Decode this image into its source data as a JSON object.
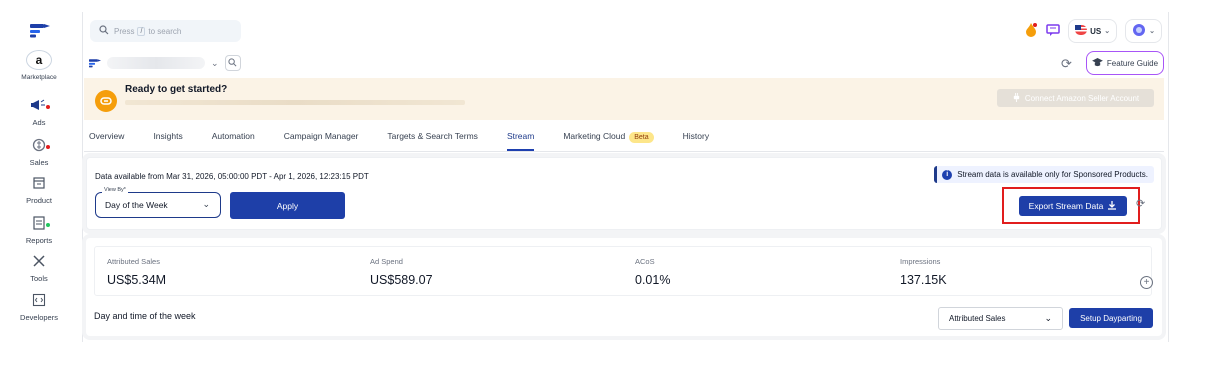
{
  "rail": {
    "marketplace_label": "Marketplace",
    "marketplace_badge": "a",
    "items": [
      {
        "label": "Ads",
        "icon": "megaphone-icon"
      },
      {
        "label": "Sales",
        "icon": "sales-icon"
      },
      {
        "label": "Product",
        "icon": "product-box-icon"
      },
      {
        "label": "Reports",
        "icon": "reports-icon"
      },
      {
        "label": "Tools",
        "icon": "tools-icon"
      },
      {
        "label": "Developers",
        "icon": "code-icon"
      }
    ]
  },
  "search": {
    "prefix": "Press",
    "key": "/",
    "suffix": "to search"
  },
  "header": {
    "locale": "US",
    "feature_guide": "Feature Guide"
  },
  "banner": {
    "title": "Ready to get started?",
    "connect_label": "Connect Amazon Seller Account"
  },
  "tabs": [
    {
      "label": "Overview",
      "active": false
    },
    {
      "label": "Insights",
      "active": false
    },
    {
      "label": "Automation",
      "active": false
    },
    {
      "label": "Campaign Manager",
      "active": false
    },
    {
      "label": "Targets & Search Terms",
      "active": false
    },
    {
      "label": "Stream",
      "active": true
    },
    {
      "label": "Marketing Cloud",
      "badge": "Beta",
      "active": false
    },
    {
      "label": "History",
      "active": false
    }
  ],
  "stream": {
    "data_range": "Data available from Mar 31, 2026, 05:00:00 PDT - Apr 1, 2026, 12:23:15 PDT",
    "view_by_label": "View By*",
    "view_by_value": "Day of the Week",
    "apply_label": "Apply",
    "info_note": "Stream data is available only for Sponsored Products.",
    "export_label": "Export Stream Data"
  },
  "metrics": [
    {
      "label": "Attributed Sales",
      "value": "US$5.34M"
    },
    {
      "label": "Ad Spend",
      "value": "US$589.07"
    },
    {
      "label": "ACoS",
      "value": "0.01%"
    },
    {
      "label": "Impressions",
      "value": "137.15K"
    }
  ],
  "section": {
    "title": "Day and time of the week",
    "metric_select": "Attributed Sales",
    "dayparting_label": "Setup Dayparting"
  },
  "colors": {
    "primary": "#1e3fa8",
    "accent_orange": "#f59e0b",
    "highlight_red": "#e11d1d",
    "feature_border": "#a855f7"
  }
}
